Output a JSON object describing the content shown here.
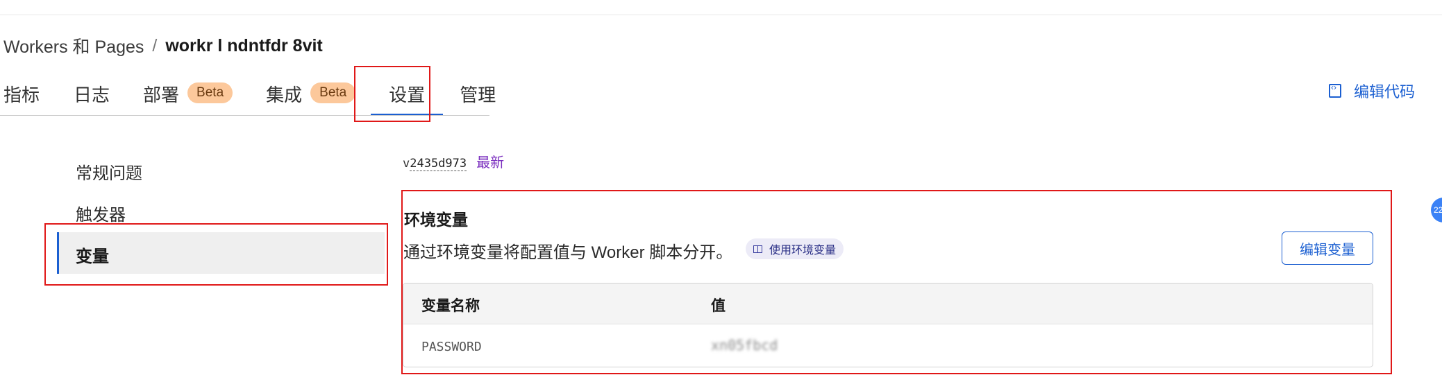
{
  "breadcrumb": {
    "root": "Workers 和 Pages",
    "separator": "/",
    "current": "workr l ndntfdr 8vit"
  },
  "tabs": [
    {
      "label": "指标",
      "badge": ""
    },
    {
      "label": "日志",
      "badge": ""
    },
    {
      "label": "部署",
      "badge": "Beta"
    },
    {
      "label": "集成",
      "badge": "Beta"
    },
    {
      "label": "设置",
      "badge": "",
      "active": true
    },
    {
      "label": "管理",
      "badge": ""
    }
  ],
  "header_actions": {
    "edit_code": "编辑代码"
  },
  "sidebar": {
    "items": [
      {
        "label": "常规问题"
      },
      {
        "label": "触发器"
      },
      {
        "label": "变量",
        "active": true
      }
    ]
  },
  "version": {
    "prefix": "v",
    "hash": "2435d973",
    "latest_label": "最新"
  },
  "env": {
    "title": "环境变量",
    "description": "通过环境变量将配置值与 Worker 脚本分开。",
    "doc_link": "使用环境变量",
    "edit_button": "编辑变量",
    "table": {
      "columns": [
        "变量名称",
        "值"
      ],
      "rows": [
        {
          "name": "PASSWORD",
          "value": "xn05fbcd"
        }
      ]
    }
  },
  "floating_badge": "22",
  "colors": {
    "accent": "#1b5fd1",
    "highlight": "#e01818",
    "beta_badge": "#fcc89b",
    "latest": "#7b2fbf"
  }
}
